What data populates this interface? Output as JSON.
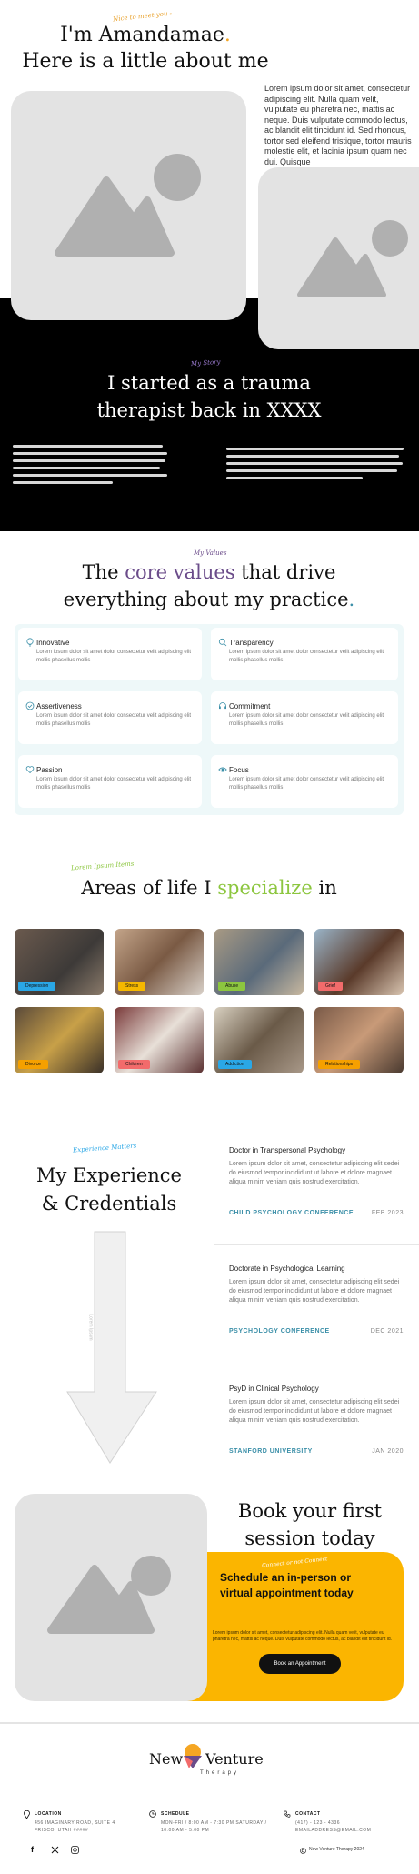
{
  "intro": {
    "script_label": "Nice to meet you -",
    "title_line1": "I'm Amandamae",
    "title_dot": ".",
    "title_line2": "Here is a little about me",
    "paragraph": "Lorem ipsum dolor sit amet, consectetur adipiscing elit. Nulla quam velit, vulputate eu pharetra nec, mattis ac neque. Duis vulputate commodo lectus, ac blandit elit tincidunt id. Sed rhoncus, tortor sed eleifend tristique, tortor mauris molestie elit, et lacinia ipsum quam nec dui. Quisque"
  },
  "story": {
    "script_label": "My Story",
    "title_line1": "I started as a trauma",
    "title_line2": "therapist back in XXXX"
  },
  "values": {
    "script_label": "My Values",
    "title_pre": "The ",
    "title_highlight": "core values",
    "title_post": " that drive",
    "title_line2": "everything about my practice",
    "title_dot": ".",
    "items": [
      {
        "icon": "lightbulb-icon",
        "title": "Innovative",
        "desc": "Lorem ipsum dolor sit amet dolor consectetur velit adipiscing elit mollis phasellus mollis"
      },
      {
        "icon": "search-icon",
        "title": "Transparency",
        "desc": "Lorem ipsum dolor sit amet dolor consectetur velit adipiscing elit mollis phasellus mollis"
      },
      {
        "icon": "check-circle-icon",
        "title": "Assertiveness",
        "desc": "Lorem ipsum dolor sit amet dolor consectetur velit adipiscing elit mollis phasellus mollis"
      },
      {
        "icon": "headset-icon",
        "title": "Commitment",
        "desc": "Lorem ipsum dolor sit amet dolor consectetur velit adipiscing elit mollis phasellus mollis"
      },
      {
        "icon": "heart-icon",
        "title": "Passion",
        "desc": "Lorem ipsum dolor sit amet dolor consectetur velit adipiscing elit mollis phasellus mollis"
      },
      {
        "icon": "eye-icon",
        "title": "Focus",
        "desc": "Lorem ipsum dolor sit amet dolor consectetur velit adipiscing elit mollis phasellus mollis"
      }
    ]
  },
  "specialize": {
    "script_label": "Lorem Ipsum Items",
    "title_pre": "Areas of life I ",
    "title_highlight": "specialize",
    "title_post": " in",
    "tiles": [
      {
        "label": "Depression",
        "tag_color": "#2aa7e6"
      },
      {
        "label": "Stress",
        "tag_color": "#f5b800"
      },
      {
        "label": "Abuse",
        "tag_color": "#8cc63f"
      },
      {
        "label": "Grief",
        "tag_color": "#f26b6b"
      },
      {
        "label": "Divorce",
        "tag_color": "#f5a000"
      },
      {
        "label": "Children",
        "tag_color": "#f26b6b"
      },
      {
        "label": "Addiction",
        "tag_color": "#2aa7e6"
      },
      {
        "label": "Relationships",
        "tag_color": "#f5a000"
      }
    ]
  },
  "experience": {
    "script_label": "Experience Matters",
    "title_line1": "My Experience",
    "title_line2": "& Credentials",
    "arrow_text": "Lorem Ipsum",
    "credentials": [
      {
        "title": "Doctor in Transpersonal Psychology",
        "body": "Lorem ipsum dolor sit amet, consectetur adipiscing elit sedei do eiusmod tempor incididunt ut labore et dolore magnaet aliqua minim veniam quis nostrud exercitation.",
        "org": "CHILD PSYCHOLOGY CONFERENCE",
        "date": "FEB 2023"
      },
      {
        "title": "Doctorate in Psychological Learning",
        "body": "Lorem ipsum dolor sit amet, consectetur adipiscing elit sedei do eiusmod tempor incididunt ut labore et dolore magnaet aliqua minim veniam quis nostrud exercitation.",
        "org": "PSYCHOLOGY CONFERENCE",
        "date": "DEC 2021"
      },
      {
        "title": "PsyD in Clinical Psychology",
        "body": "Lorem ipsum dolor sit amet, consectetur adipiscing elit sedei do eiusmod tempor incididunt ut labore et dolore magnaet aliqua minim veniam quis nostrud exercitation.",
        "org": "STANFORD UNIVERSITY",
        "date": "JAN 2020"
      }
    ]
  },
  "booking": {
    "title_line1": "Book your first",
    "title_line2": "session today",
    "script_label": "Connect or not Connect",
    "card_title": "Schedule an in-person or virtual appointment today",
    "card_body": "Lorem ipsum dolor sit amet, consectetur adipiscing elit. Nulla quam velit, vulputate eu pharetra nec, mattis ac neque. Duis vulputate commodo lectus, ac blandit elit tincidunt id.",
    "button_label": "Book an Appointment"
  },
  "footer": {
    "brand_left": "New",
    "brand_right": "Venture",
    "brand_sub": "Therapy",
    "location_label": "LOCATION",
    "location_value": "456 IMAGINARY ROAD, SUITE 4 FRISCO, UTAH #####",
    "schedule_label": "SCHEDULE",
    "schedule_value": "MON-FRI / 8:00 AM - 7:30 PM SATURDAY / 10:00 AM - 5:00 PM",
    "contact_label": "CONTACT",
    "contact_value": "(417) - 123 - 4336 EMAILADDRESS@EMAIL.COM",
    "copyright": "New Venture Therapy 2024",
    "colors": {
      "accent_orange": "#f5a623",
      "accent_purple": "#6b4c8a",
      "accent_green": "#8cc63f",
      "teal": "#3b8fa8",
      "yellow": "#fbb500"
    }
  }
}
